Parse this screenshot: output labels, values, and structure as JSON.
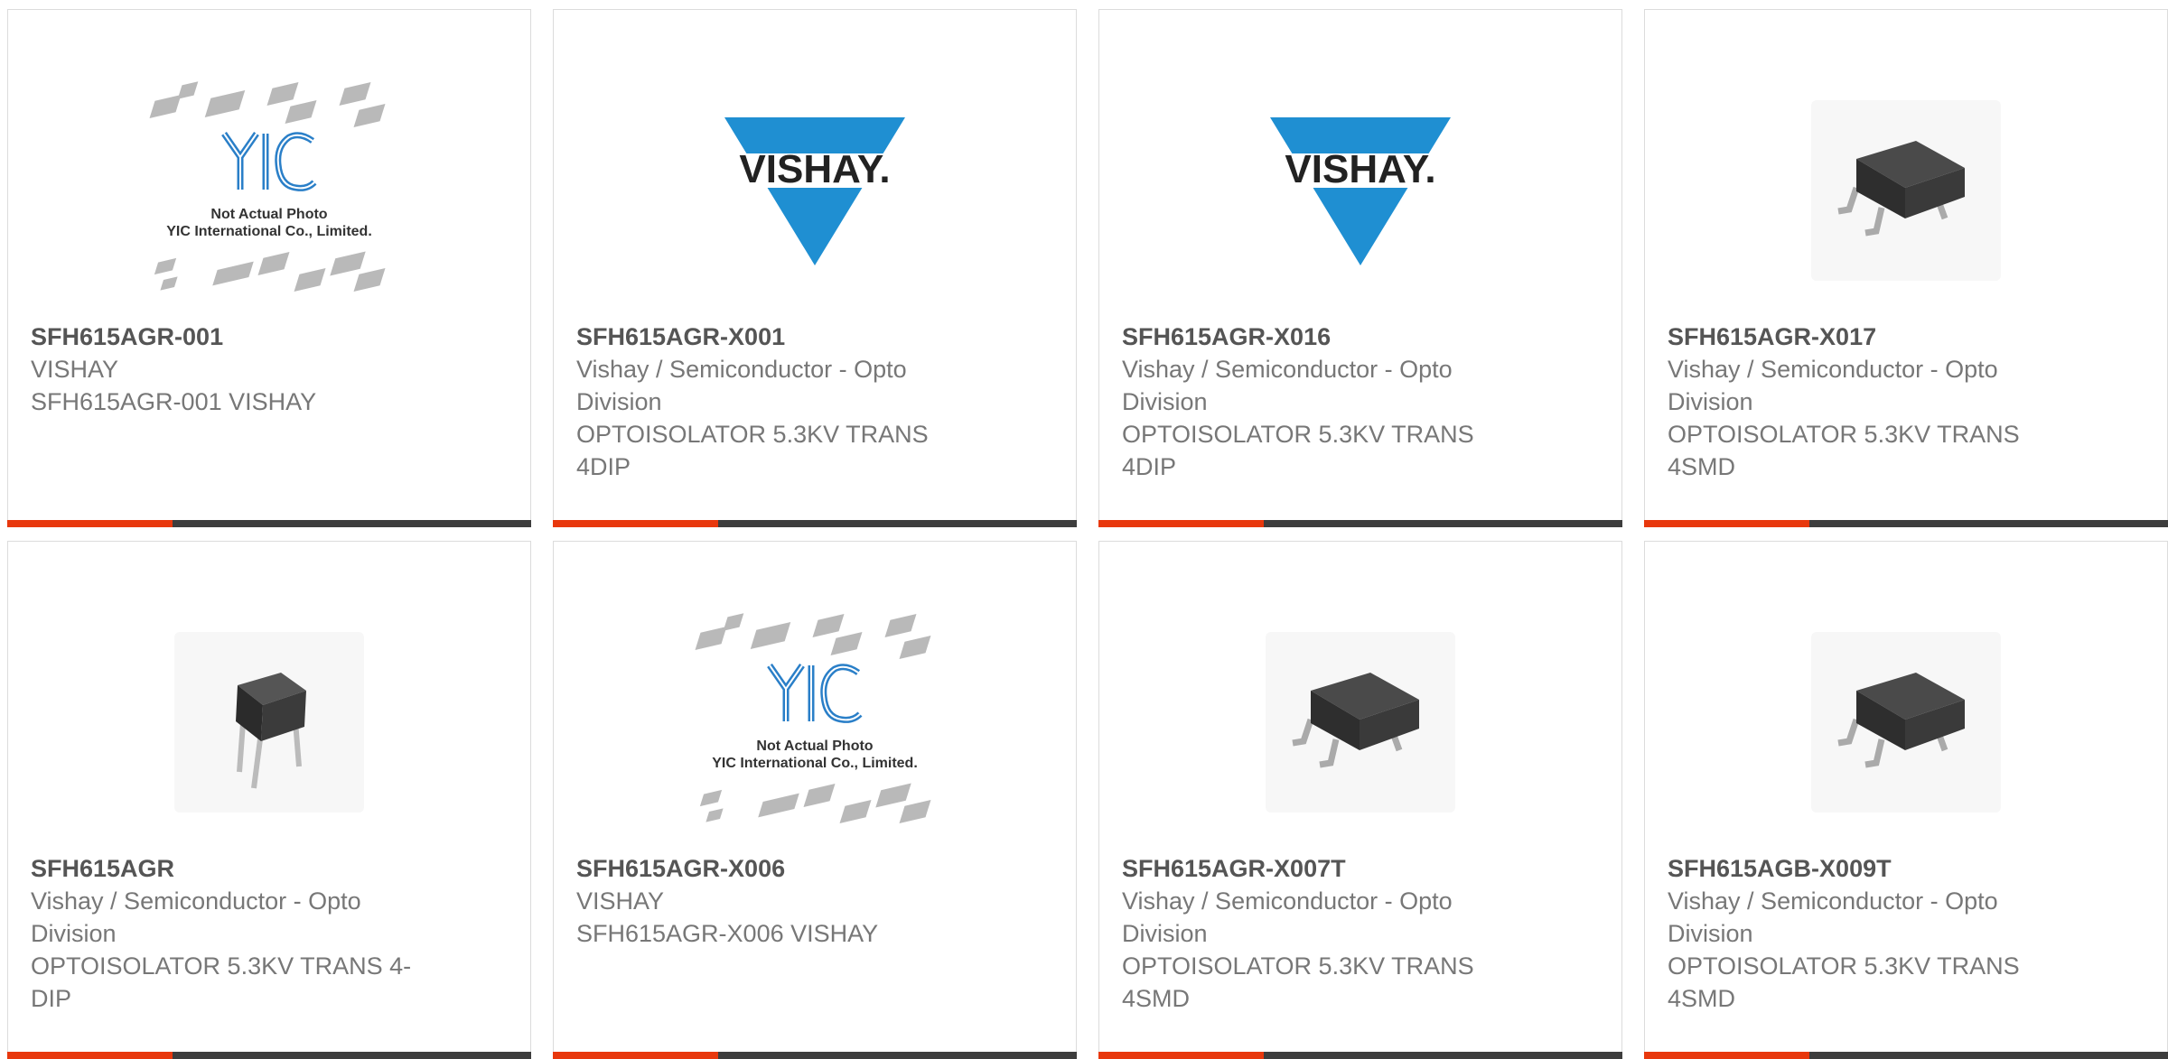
{
  "products": [
    {
      "part": "SFH615AGR-001",
      "manufacturer": "VISHAY",
      "description": "SFH615AGR-001 VISHAY",
      "image": "yic-placeholder",
      "image_caption_1": "Not Actual Photo",
      "image_caption_2": "YIC International Co., Limited."
    },
    {
      "part": "SFH615AGR-X001",
      "manufacturer": "Vishay / Semiconductor - Opto Division",
      "description": "OPTOISOLATOR 5.3KV TRANS 4DIP",
      "image": "vishay-logo",
      "logo_text": "VISHAY."
    },
    {
      "part": "SFH615AGR-X016",
      "manufacturer": "Vishay / Semiconductor - Opto Division",
      "description": "OPTOISOLATOR 5.3KV TRANS 4DIP",
      "image": "vishay-logo",
      "logo_text": "VISHAY."
    },
    {
      "part": "SFH615AGR-X017",
      "manufacturer": "Vishay / Semiconductor - Opto Division",
      "description": "OPTOISOLATOR 5.3KV TRANS 4SMD",
      "image": "smd-chip"
    },
    {
      "part": "SFH615AGR",
      "manufacturer": "Vishay / Semiconductor - Opto Division",
      "description": "OPTOISOLATOR 5.3KV TRANS 4-DIP",
      "image": "dip-chip"
    },
    {
      "part": "SFH615AGR-X006",
      "manufacturer": "VISHAY",
      "description": "SFH615AGR-X006 VISHAY",
      "image": "yic-placeholder",
      "image_caption_1": "Not Actual Photo",
      "image_caption_2": "YIC International Co., Limited."
    },
    {
      "part": "SFH615AGR-X007T",
      "manufacturer": "Vishay / Semiconductor - Opto Division",
      "description": "OPTOISOLATOR 5.3KV TRANS 4SMD",
      "image": "smd-chip"
    },
    {
      "part": "SFH615AGB-X009T",
      "manufacturer": "Vishay / Semiconductor - Opto Division",
      "description": "OPTOISOLATOR 5.3KV TRANS 4SMD",
      "image": "smd-chip"
    }
  ],
  "colors": {
    "accent": "#e8380d",
    "bar": "#3d3d3d",
    "vishay_blue": "#1f8fd2",
    "yic_blue": "#2a7fc8"
  }
}
